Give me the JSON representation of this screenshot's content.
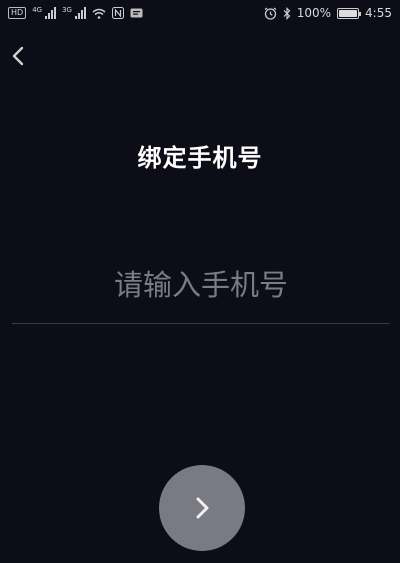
{
  "status_bar": {
    "hd_label": "HD",
    "net1": "4G",
    "net2": "3G",
    "battery_text": "100%",
    "battery_level": 1.0,
    "time": "4:55",
    "icons": [
      "signal-icon",
      "wifi-icon",
      "nfc-icon",
      "message-icon",
      "alarm-icon",
      "bluetooth-icon",
      "battery-icon"
    ]
  },
  "header": {
    "back_icon": "chevron-left-icon",
    "title": "绑定手机号"
  },
  "form": {
    "phone_placeholder": "请输入手机号",
    "phone_value": ""
  },
  "next_button": {
    "icon": "chevron-right-icon"
  },
  "colors": {
    "background": "#0d0d18",
    "caret": "#2f7ff0",
    "button": "#7a7a84",
    "placeholder": "#7b7b86",
    "divider": "#3a3a46"
  }
}
